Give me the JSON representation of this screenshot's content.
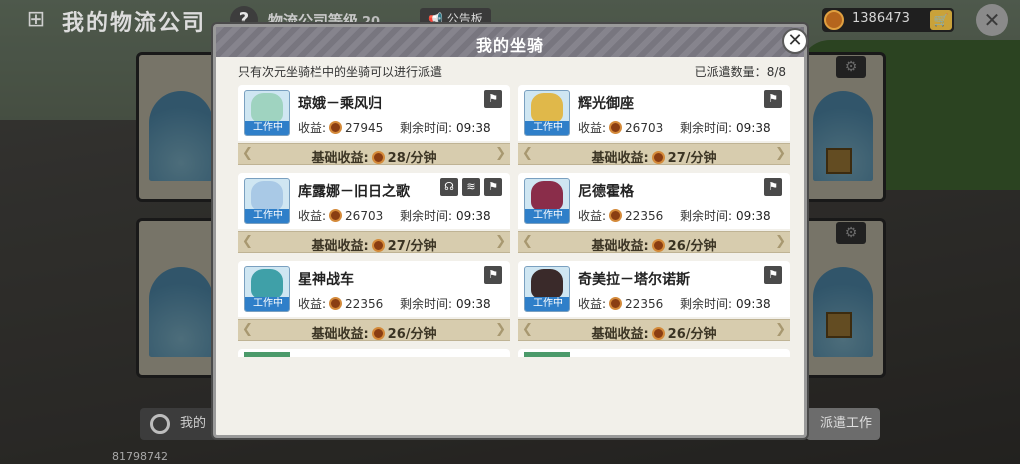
{
  "topbar": {
    "home_icon": "grid-home-icon",
    "title": "我的物流公司",
    "help_label": "?",
    "level_label": "物流公司等级",
    "level_value": "20",
    "board_label": "公告板",
    "coins": "1386473",
    "cart_icon": "cart-icon",
    "close_label": "✕"
  },
  "bottom": {
    "left_button": "我的",
    "id_text": "81798742",
    "right_button": "派遣工作"
  },
  "modal": {
    "title": "我的坐骑",
    "notice": "只有次元坐骑栏中的坐骑可以进行派遣",
    "dispatched_label": "已派遣数量：",
    "dispatched_value": "8/8",
    "close_label": "✕",
    "earn_label": "收益:",
    "remain_label": "剩余时间:",
    "base_label": "基础收益:",
    "status_tag": "工作中",
    "mounts": [
      {
        "name": "琼娥－乘风归",
        "earn": "27945",
        "remain": "09:38",
        "rate": "28/分钟",
        "color": "#9fd3c0"
      },
      {
        "name": "辉光御座",
        "earn": "26703",
        "remain": "09:38",
        "rate": "27/分钟",
        "color": "#e0b84a"
      },
      {
        "name": "库露娜－旧日之歌",
        "earn": "26703",
        "remain": "09:38",
        "rate": "27/分钟",
        "color": "#a9c9e6"
      },
      {
        "name": "尼德霍格",
        "earn": "22356",
        "remain": "09:38",
        "rate": "26/分钟",
        "color": "#8a2d4a"
      },
      {
        "name": "星神战车",
        "earn": "22356",
        "remain": "09:38",
        "rate": "26/分钟",
        "color": "#3fa0a8"
      },
      {
        "name": "奇美拉－塔尔诺斯",
        "earn": "22356",
        "remain": "09:38",
        "rate": "26/分钟",
        "color": "#3a2a2a"
      }
    ]
  }
}
